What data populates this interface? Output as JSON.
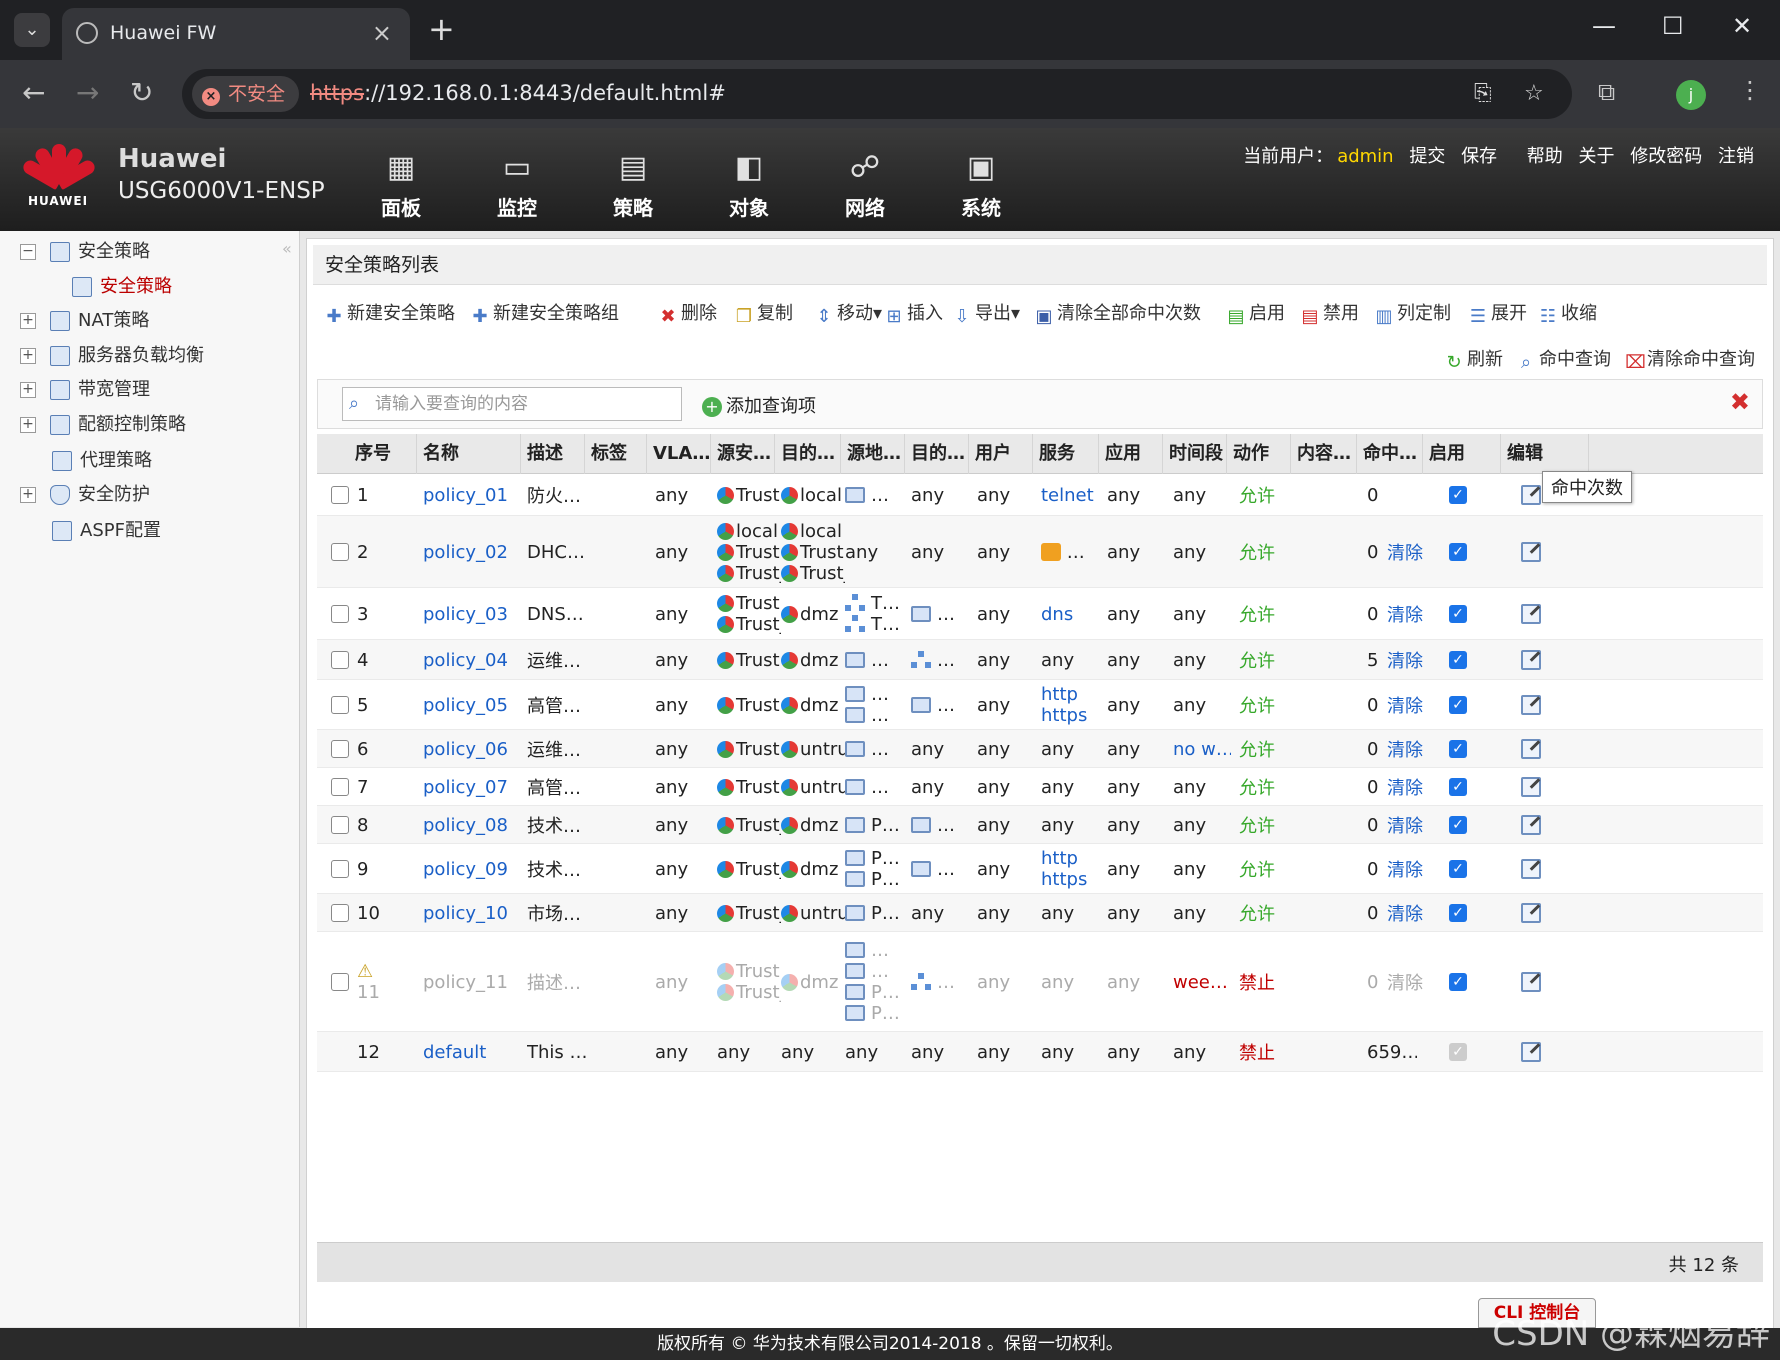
{
  "browser": {
    "tab_title": "Huawei FW",
    "insecure_label": "不安全",
    "url_scheme": "https",
    "url_rest": "://192.168.0.1:8443/default.html#",
    "profile_initial": "j"
  },
  "header": {
    "brand_name": "Huawei",
    "model": "USG6000V1-ENSP",
    "logo_text": "HUAWEI",
    "nav": [
      {
        "label": "面板",
        "icon": "dashboard-icon"
      },
      {
        "label": "监控",
        "icon": "monitor-icon"
      },
      {
        "label": "策略",
        "icon": "policy-icon"
      },
      {
        "label": "对象",
        "icon": "object-icon"
      },
      {
        "label": "网络",
        "icon": "network-icon"
      },
      {
        "label": "系统",
        "icon": "system-icon"
      }
    ],
    "user_label": "当前用户：",
    "user_name": "admin",
    "actions": [
      "提交",
      "保存",
      "帮助",
      "关于",
      "修改密码",
      "注销"
    ]
  },
  "sidebar": {
    "items": [
      {
        "label": "安全策略"
      },
      {
        "label": "安全策略"
      },
      {
        "label": "NAT策略"
      },
      {
        "label": "服务器负载均衡"
      },
      {
        "label": "带宽管理"
      },
      {
        "label": "配额控制策略"
      },
      {
        "label": "代理策略"
      },
      {
        "label": "安全防护"
      },
      {
        "label": "ASPF配置"
      }
    ]
  },
  "main": {
    "title": "安全策略列表",
    "toolbar": [
      "新建安全策略",
      "新建安全策略组",
      "删除",
      "复制",
      "移动▾",
      "插入",
      "导出▾",
      "清除全部命中次数",
      "启用",
      "禁用",
      "列定制",
      "展开",
      "收缩"
    ],
    "toolbar2": [
      "刷新",
      "命中查询",
      "清除命中查询"
    ],
    "search_placeholder": "请输入要查询的内容",
    "add_query": "添加查询项",
    "columns": [
      "序号",
      "名称",
      "描述",
      "标签",
      "VLA…",
      "源安…",
      "目的…",
      "源地…",
      "目的…",
      "用户",
      "服务",
      "应用",
      "时间段",
      "动作",
      "内容…",
      "命中…",
      "启用",
      "编辑"
    ],
    "tooltip": "命中次数",
    "total": "共 12 条"
  },
  "rows": [
    {
      "id": "1",
      "name": "policy_01",
      "desc": "防火…",
      "vlan": "any",
      "src_zone": [
        "Trust"
      ],
      "dst_zone": [
        "local"
      ],
      "src_addr": [
        "…"
      ],
      "dst_addr": "any",
      "user": "any",
      "service": [
        "telnet"
      ],
      "app": "any",
      "time": "any",
      "action": "允许",
      "hits": "0",
      "clear": "",
      "enabled": true
    },
    {
      "id": "2",
      "name": "policy_02",
      "desc": "DHC…",
      "vlan": "any",
      "src_zone": [
        "local",
        "Trust",
        "Trust_"
      ],
      "dst_zone": [
        "local",
        "Trust",
        "Trust_"
      ],
      "src_addr": [
        "any"
      ],
      "dst_addr": "any",
      "user": "any",
      "service": [
        "…"
      ],
      "app": "any",
      "time": "any",
      "action": "允许",
      "hits": "0",
      "clear": "清除",
      "enabled": true
    },
    {
      "id": "3",
      "name": "policy_03",
      "desc": "DNS…",
      "vlan": "any",
      "src_zone": [
        "Trust",
        "Trust_"
      ],
      "dst_zone": [
        "dmz"
      ],
      "src_addr": [
        "T…",
        "T…"
      ],
      "dst_addr": "…",
      "user": "any",
      "service": [
        "dns"
      ],
      "app": "any",
      "time": "any",
      "action": "允许",
      "hits": "0",
      "clear": "清除",
      "enabled": true
    },
    {
      "id": "4",
      "name": "policy_04",
      "desc": "运维…",
      "vlan": "any",
      "src_zone": [
        "Trust"
      ],
      "dst_zone": [
        "dmz"
      ],
      "src_addr": [
        "…"
      ],
      "dst_addr": "…",
      "user": "any",
      "service": [
        "any"
      ],
      "app": "any",
      "time": "any",
      "action": "允许",
      "hits": "5",
      "clear": "清除",
      "enabled": true
    },
    {
      "id": "5",
      "name": "policy_05",
      "desc": "高管…",
      "vlan": "any",
      "src_zone": [
        "Trust"
      ],
      "dst_zone": [
        "dmz"
      ],
      "src_addr": [
        "…",
        "…"
      ],
      "dst_addr": "…",
      "user": "any",
      "service": [
        "http",
        "https"
      ],
      "app": "any",
      "time": "any",
      "action": "允许",
      "hits": "0",
      "clear": "清除",
      "enabled": true
    },
    {
      "id": "6",
      "name": "policy_06",
      "desc": "运维…",
      "vlan": "any",
      "src_zone": [
        "Trust"
      ],
      "dst_zone": [
        "untrus"
      ],
      "src_addr": [
        "…"
      ],
      "dst_addr": "any",
      "user": "any",
      "service": [
        "any"
      ],
      "app": "any",
      "time": "no w…",
      "action": "允许",
      "hits": "0",
      "clear": "清除",
      "enabled": true
    },
    {
      "id": "7",
      "name": "policy_07",
      "desc": "高管…",
      "vlan": "any",
      "src_zone": [
        "Trust"
      ],
      "dst_zone": [
        "untrus"
      ],
      "src_addr": [
        "…"
      ],
      "dst_addr": "any",
      "user": "any",
      "service": [
        "any"
      ],
      "app": "any",
      "time": "any",
      "action": "允许",
      "hits": "0",
      "clear": "清除",
      "enabled": true
    },
    {
      "id": "8",
      "name": "policy_08",
      "desc": "技术…",
      "vlan": "any",
      "src_zone": [
        "Trust_"
      ],
      "dst_zone": [
        "dmz"
      ],
      "src_addr": [
        "P…"
      ],
      "dst_addr": "…",
      "user": "any",
      "service": [
        "any"
      ],
      "app": "any",
      "time": "any",
      "action": "允许",
      "hits": "0",
      "clear": "清除",
      "enabled": true
    },
    {
      "id": "9",
      "name": "policy_09",
      "desc": "技术…",
      "vlan": "any",
      "src_zone": [
        "Trust_"
      ],
      "dst_zone": [
        "dmz"
      ],
      "src_addr": [
        "P…",
        "P…"
      ],
      "dst_addr": "…",
      "user": "any",
      "service": [
        "http",
        "https"
      ],
      "app": "any",
      "time": "any",
      "action": "允许",
      "hits": "0",
      "clear": "清除",
      "enabled": true
    },
    {
      "id": "10",
      "name": "policy_10",
      "desc": "市场…",
      "vlan": "any",
      "src_zone": [
        "Trust_"
      ],
      "dst_zone": [
        "untrus"
      ],
      "src_addr": [
        "P…"
      ],
      "dst_addr": "any",
      "user": "any",
      "service": [
        "any"
      ],
      "app": "any",
      "time": "any",
      "action": "允许",
      "hits": "0",
      "clear": "清除",
      "enabled": true
    },
    {
      "id": "11",
      "name": "policy_11",
      "desc": "描述…",
      "vlan": "any",
      "src_zone": [
        "Trust",
        "Trust_"
      ],
      "dst_zone": [
        "dmz"
      ],
      "src_addr": [
        "…",
        "…",
        "P…",
        "P…"
      ],
      "dst_addr": "…",
      "user": "any",
      "service": [
        "any"
      ],
      "app": "any",
      "time": "wee…",
      "action": "禁止",
      "hits": "0",
      "clear": "清除",
      "enabled": true
    },
    {
      "id": "12",
      "name": "default",
      "desc": "This …",
      "vlan": "any",
      "src_zone": [
        "any"
      ],
      "dst_zone": [
        "any"
      ],
      "src_addr": [
        "any"
      ],
      "dst_addr": "any",
      "user": "any",
      "service": [
        "any"
      ],
      "app": "any",
      "time": "any",
      "action": "禁止",
      "hits": "659…",
      "clear": "",
      "enabled": true
    }
  ],
  "cli_button": "CLI 控制台",
  "footer": "版权所有 © 华为技术有限公司2014-2018 。保留一切权利。",
  "watermark": "CSDN @霖烟易辞"
}
